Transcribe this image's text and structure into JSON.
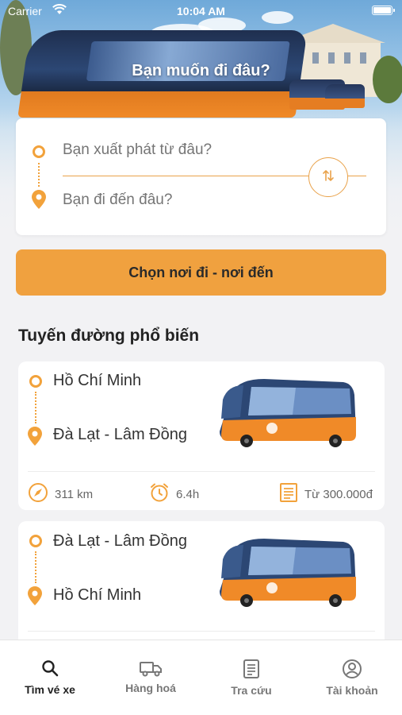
{
  "status_bar": {
    "carrier": "Carrier",
    "time": "10:04 AM"
  },
  "hero": {
    "title": "Bạn muốn đi đâu?"
  },
  "search": {
    "origin_placeholder": "Bạn xuất phát từ đâu?",
    "destination_placeholder": "Bạn đi đến đâu?"
  },
  "primary_button": "Chọn nơi đi - nơi đến",
  "section_title": "Tuyến đường phổ biến",
  "routes": [
    {
      "from": "Hồ Chí Minh",
      "to": "Đà Lạt - Lâm Đồng",
      "distance": "311 km",
      "duration": "6.4h",
      "price": "Từ 300.000đ"
    },
    {
      "from": "Đà Lạt - Lâm Đồng",
      "to": "Hồ Chí Minh"
    }
  ],
  "tabs": [
    {
      "label": "Tìm vé xe",
      "icon": "search-icon",
      "active": true
    },
    {
      "label": "Hàng hoá",
      "icon": "truck-icon",
      "active": false
    },
    {
      "label": "Tra cứu",
      "icon": "document-icon",
      "active": false
    },
    {
      "label": "Tài khoản",
      "icon": "account-icon",
      "active": false
    }
  ],
  "colors": {
    "accent": "#f0a13f",
    "accent_stroke": "#e9a24a",
    "bus_orange": "#f08a28",
    "bus_blue": "#2c4774"
  }
}
